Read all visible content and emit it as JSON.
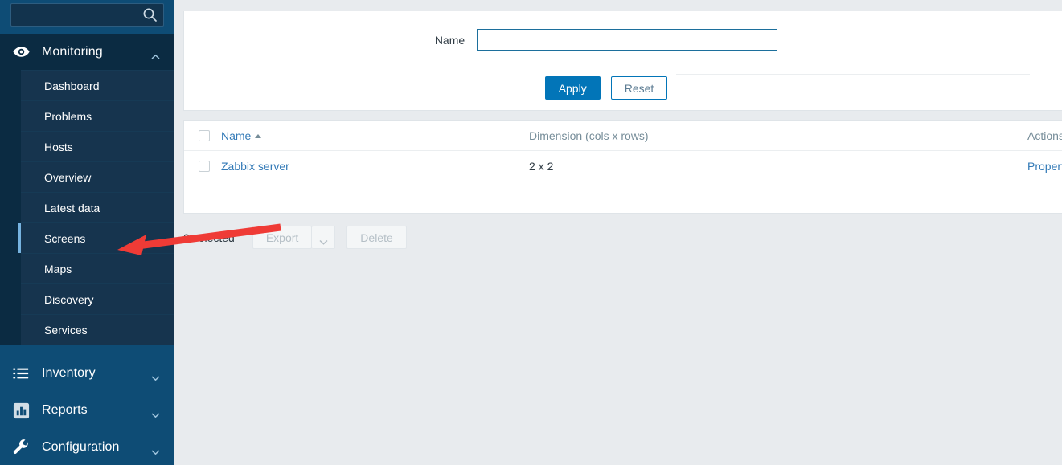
{
  "sidebar": {
    "search": {
      "value": "",
      "placeholder": "",
      "icon": "search-icon"
    },
    "sections": [
      {
        "label": "Monitoring",
        "icon": "eye-icon",
        "chevron": "chevron-up-icon",
        "expanded": true,
        "items": [
          {
            "label": "Dashboard",
            "selected": false
          },
          {
            "label": "Problems",
            "selected": false
          },
          {
            "label": "Hosts",
            "selected": false
          },
          {
            "label": "Overview",
            "selected": false
          },
          {
            "label": "Latest data",
            "selected": false
          },
          {
            "label": "Screens",
            "selected": true
          },
          {
            "label": "Maps",
            "selected": false
          },
          {
            "label": "Discovery",
            "selected": false
          },
          {
            "label": "Services",
            "selected": false
          }
        ]
      },
      {
        "label": "Inventory",
        "icon": "list-icon",
        "chevron": "chevron-down-icon",
        "expanded": false,
        "items": []
      },
      {
        "label": "Reports",
        "icon": "bar-chart-icon",
        "chevron": "chevron-down-icon",
        "expanded": false,
        "items": []
      },
      {
        "label": "Configuration",
        "icon": "wrench-icon",
        "chevron": "chevron-down-icon",
        "expanded": false,
        "items": []
      }
    ]
  },
  "filter": {
    "name_label": "Name",
    "name_value": "",
    "name_placeholder": "",
    "apply_label": "Apply",
    "reset_label": "Reset"
  },
  "table": {
    "columns": [
      {
        "label": "Name",
        "sorted": "asc"
      },
      {
        "label": "Dimension (cols x rows)",
        "sorted": ""
      },
      {
        "label": "Actions",
        "sorted": ""
      }
    ],
    "rows": [
      {
        "name": "Zabbix server",
        "dimension": "2 x 2",
        "action": "Properties"
      }
    ]
  },
  "footer": {
    "selected_text": "0 selected",
    "export_label": "Export",
    "export_chevron": "chevron-down-icon",
    "delete_label": "Delete"
  },
  "colors": {
    "sidebar_bg": "#0e4c75",
    "sidebar_submenu_bg": "#16344e",
    "sidebar_section_expanded_bg": "#0b2b42",
    "accent_blue": "#0275b8",
    "link_blue": "#337ab7",
    "selected_marker": "#76b3e0",
    "page_bg": "#e8ebee",
    "annotation_arrow": "#ef3b36"
  }
}
